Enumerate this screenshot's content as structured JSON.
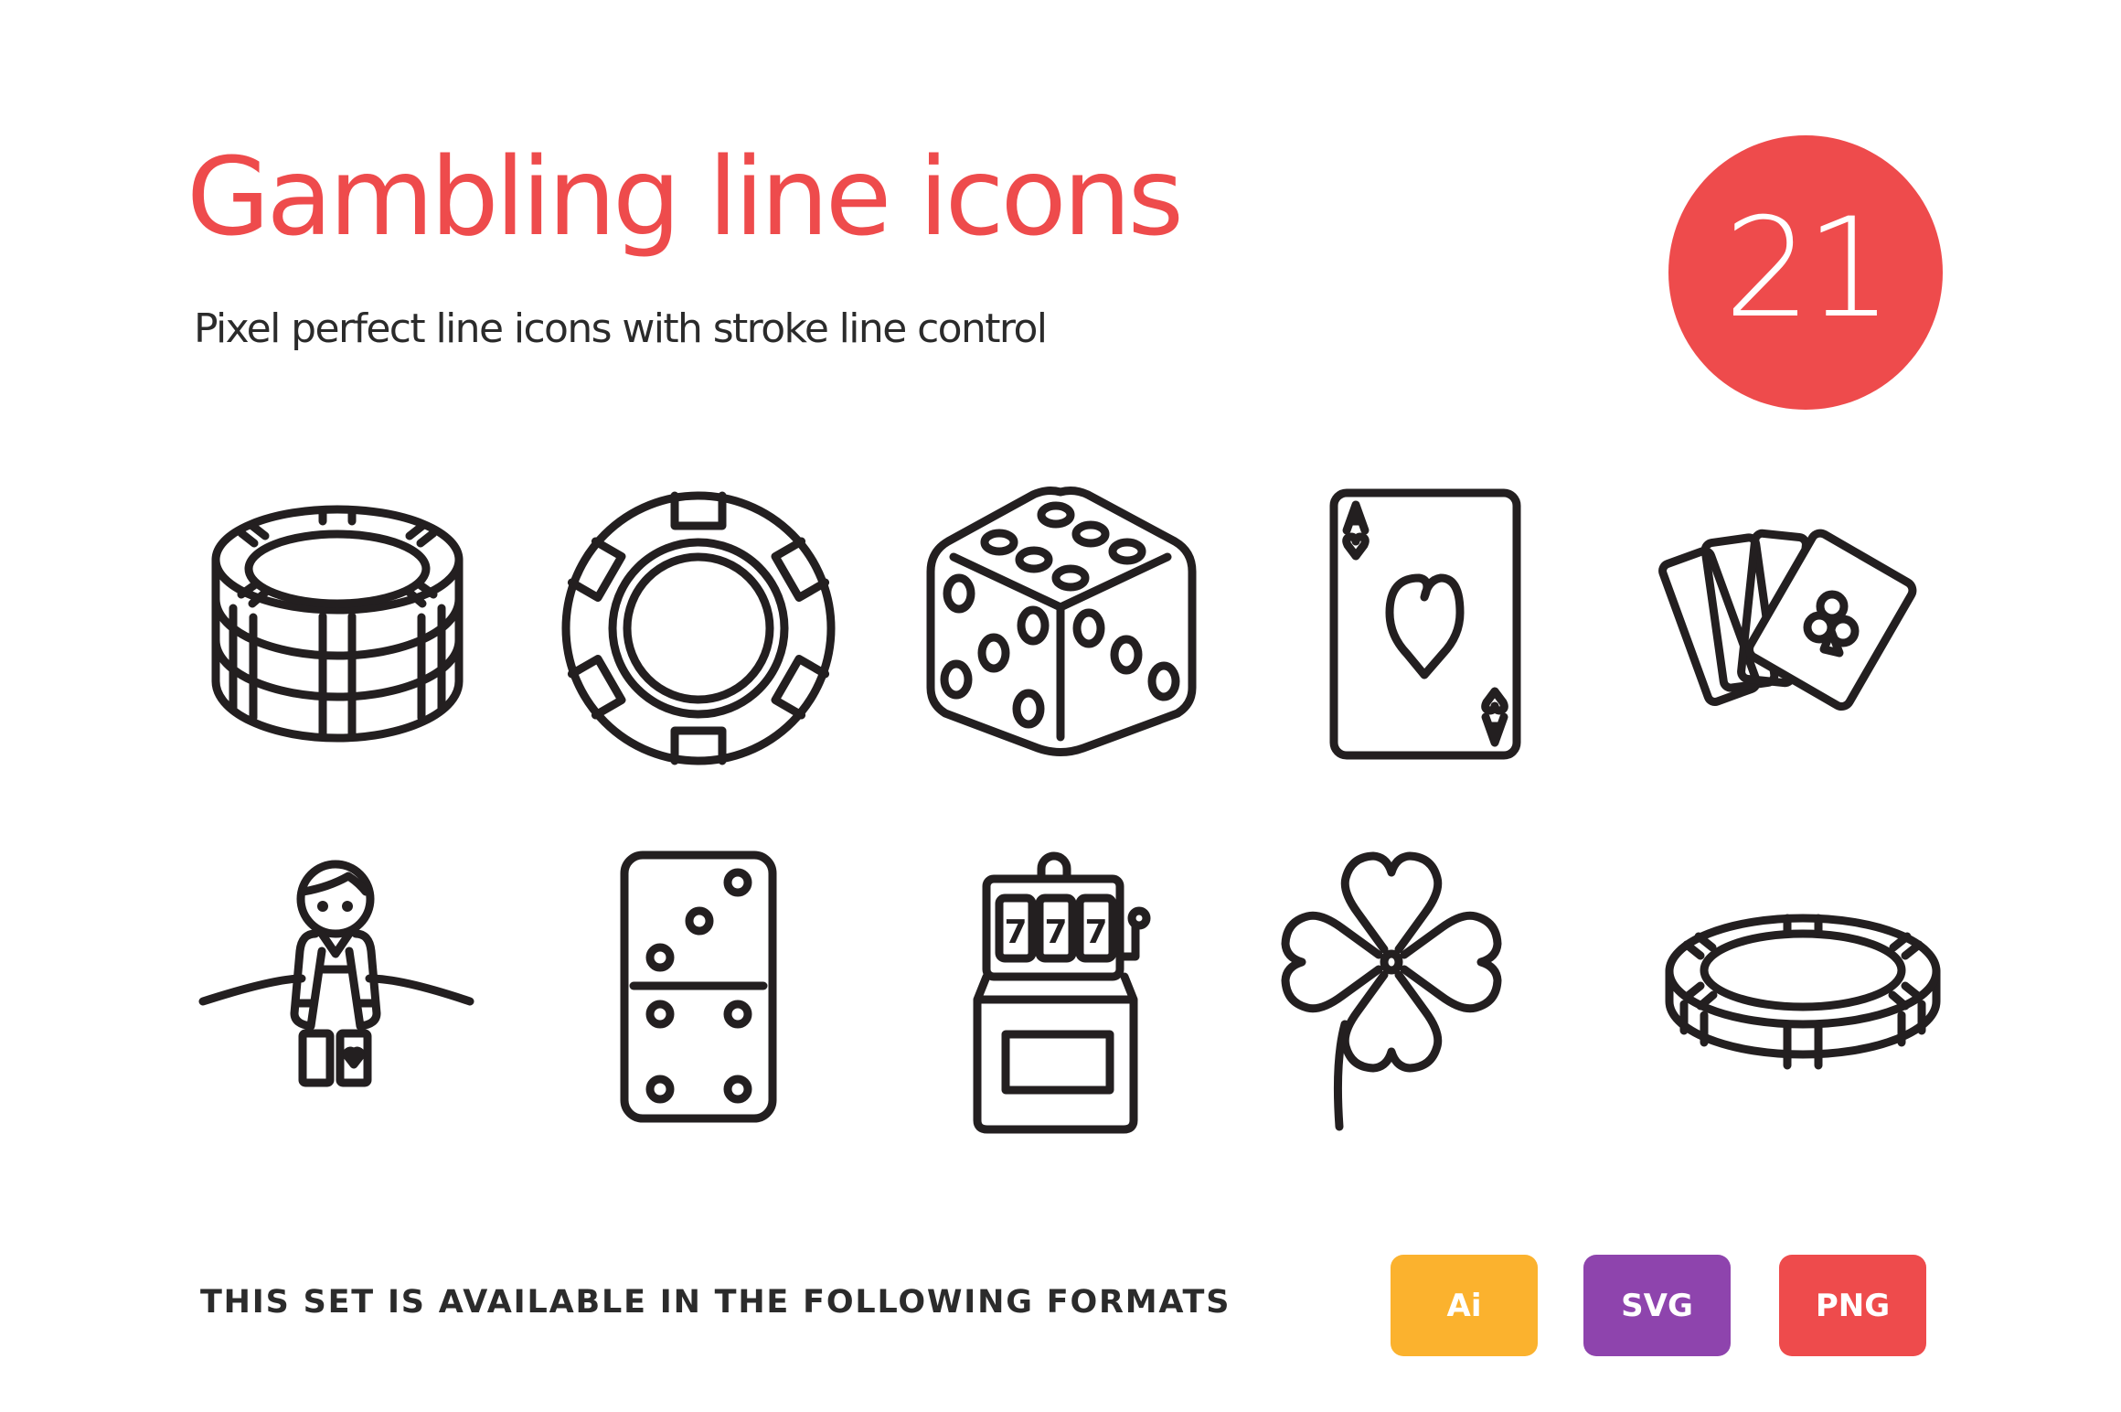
{
  "header": {
    "title": "Gambling line icons",
    "subtitle": "Pixel perfect line icons with stroke line control"
  },
  "icon_count_badge": {
    "value": "21",
    "color": "#ee4b4c"
  },
  "icons": [
    {
      "name": "chip-stack",
      "label": "Stack of casino chips"
    },
    {
      "name": "poker-chip",
      "label": "Poker chip"
    },
    {
      "name": "dice",
      "label": "Dice"
    },
    {
      "name": "ace-of-hearts",
      "label": "Ace of hearts card",
      "rank": "A",
      "suit": "heart"
    },
    {
      "name": "card-hand",
      "label": "Fan of playing cards",
      "suit": "club"
    },
    {
      "name": "croupier",
      "label": "Croupier at table"
    },
    {
      "name": "domino",
      "label": "Domino tile",
      "top_pips": 3,
      "bottom_pips": 4
    },
    {
      "name": "slot-machine",
      "label": "Slot machine",
      "reels": [
        "7",
        "7",
        "7"
      ]
    },
    {
      "name": "four-leaf-clover",
      "label": "Four-leaf clover"
    },
    {
      "name": "single-chip",
      "label": "Casino chip"
    }
  ],
  "formats": {
    "label": "THIS SET IS AVAILABLE IN THE FOLLOWING FORMATS",
    "items": [
      {
        "label": "Ai",
        "color": "#fbb22e"
      },
      {
        "label": "SVG",
        "color": "#8e44ad"
      },
      {
        "label": "PNG",
        "color": "#ee4b4c"
      }
    ]
  },
  "colors": {
    "accent": "#ee4b4c",
    "text": "#2b2b2b",
    "icon_stroke": "#231f20",
    "background": "#ffffff"
  }
}
